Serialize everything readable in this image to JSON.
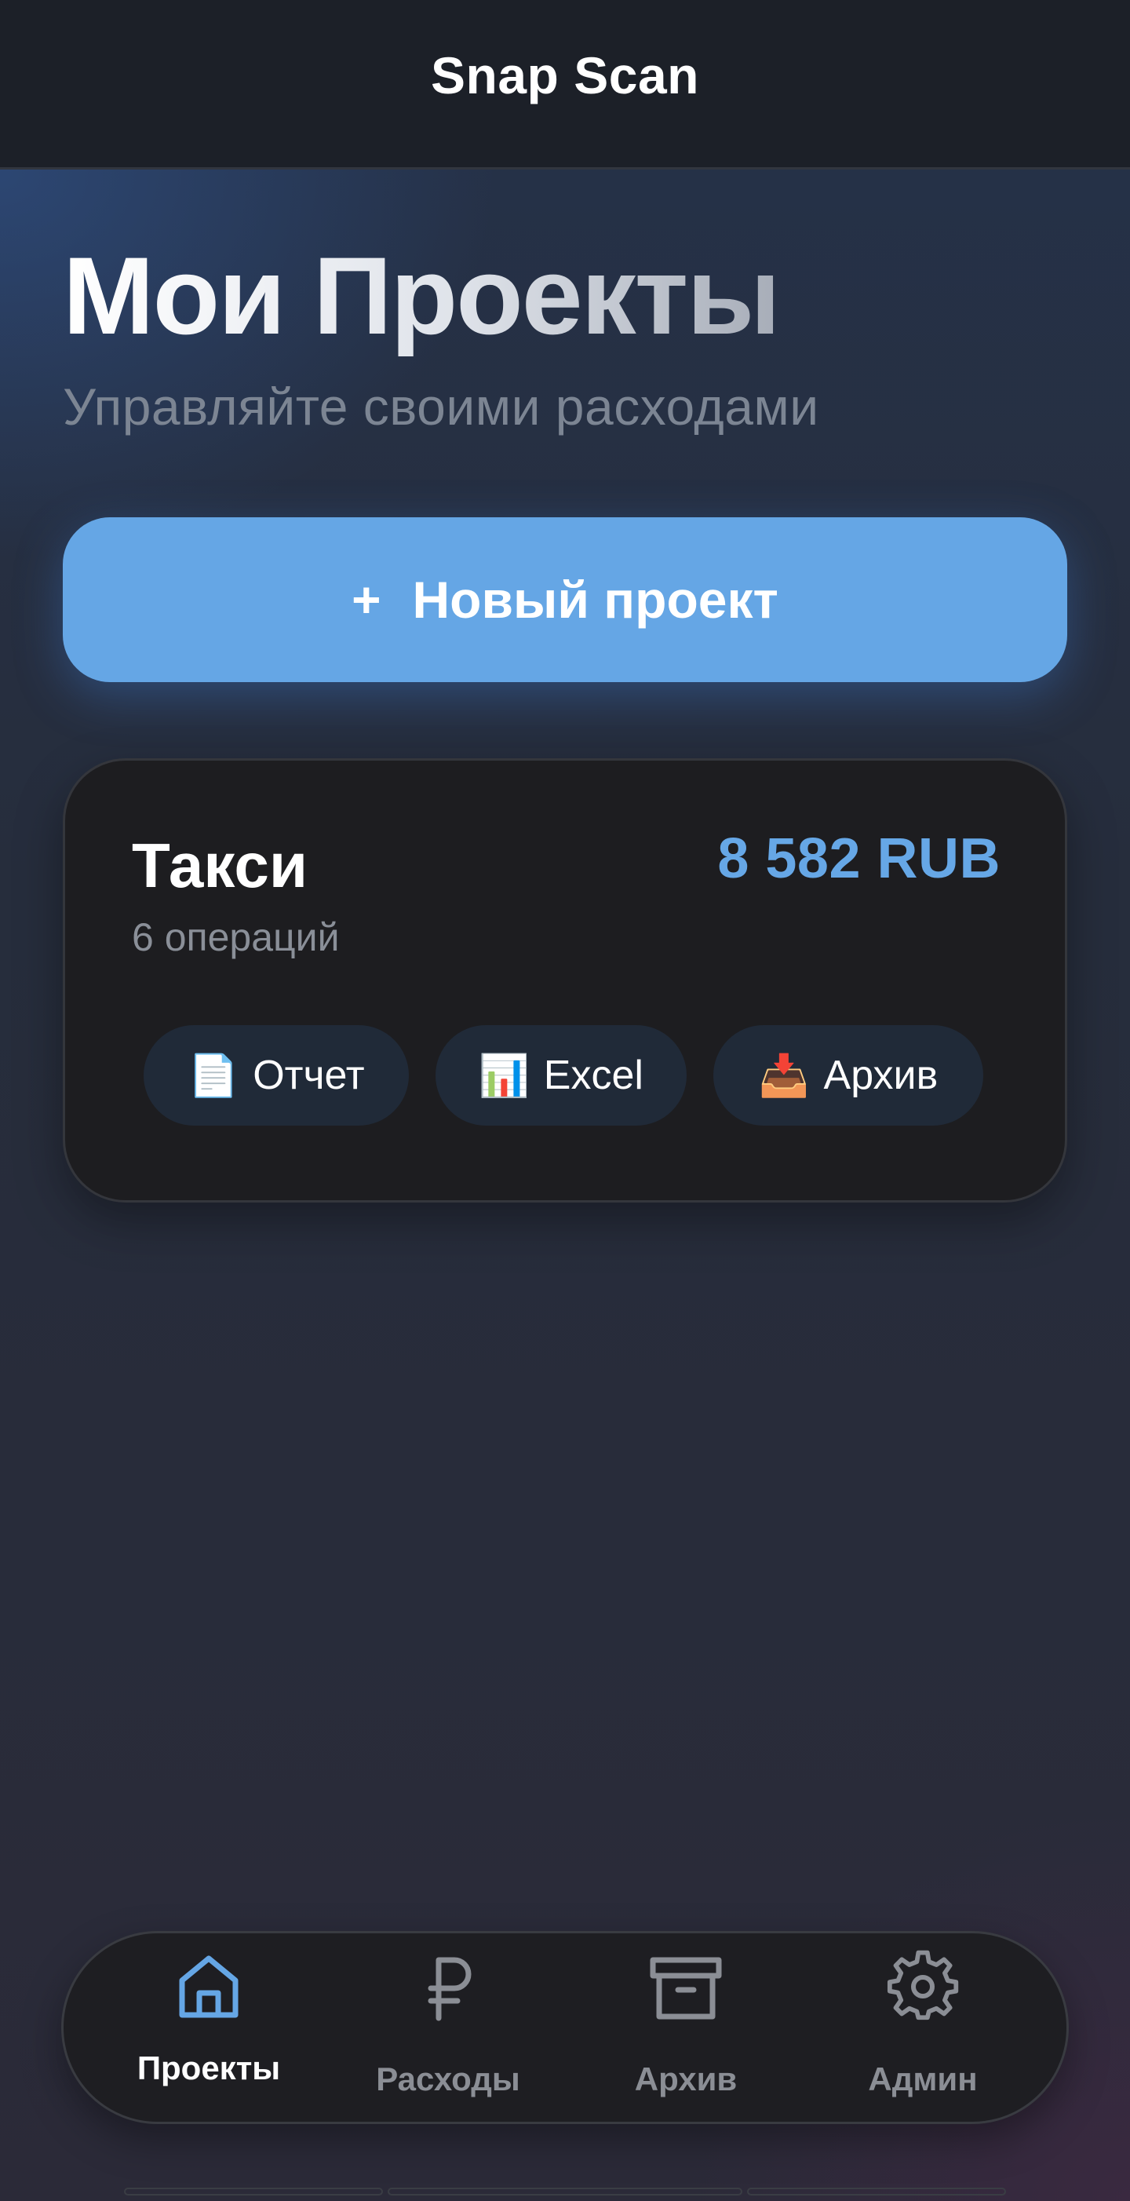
{
  "app": {
    "title": "Snap Scan"
  },
  "header": {
    "title": "Мои Проекты",
    "subtitle": "Управляйте своими расходами"
  },
  "new_project_button": {
    "icon": "+",
    "label": "Новый проект"
  },
  "projects": [
    {
      "name": "Такси",
      "operations": "6 операций",
      "amount": "8 582 RUB",
      "actions": [
        {
          "icon": "document-icon",
          "glyph": "📄",
          "label": "Отчет"
        },
        {
          "icon": "bar-chart-icon",
          "glyph": "📊",
          "label": "Excel"
        },
        {
          "icon": "inbox-tray-icon",
          "glyph": "📥",
          "label": "Архив"
        }
      ]
    }
  ],
  "bottom_nav": {
    "active": "Проекты",
    "items": [
      {
        "icon": "home-icon",
        "label": "Проекты"
      },
      {
        "icon": "ruble-icon",
        "label": "Расходы"
      },
      {
        "icon": "archive-box-icon",
        "label": "Архив"
      },
      {
        "icon": "gear-icon",
        "label": "Админ"
      }
    ]
  },
  "colors": {
    "accent": "#65a6e5",
    "card_bg": "#1d1d20",
    "topbar_bg": "#1c2028",
    "muted_text": "#8a8f98"
  }
}
